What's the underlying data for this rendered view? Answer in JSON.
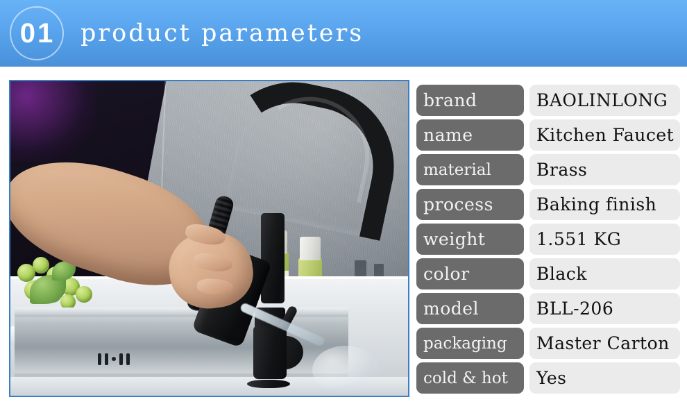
{
  "header": {
    "badge_number": "01",
    "title": "product parameters",
    "gradient_top": "#68b2f6",
    "gradient_bottom": "#4a90d9"
  },
  "photo": {
    "caption": "hand holding black pull-down kitchen faucet sprayer over stainless steel sink",
    "border_color": "#3c7ec4"
  },
  "spec_table": {
    "label_bg": "#6b6b6b",
    "value_bg": "#ebebeb",
    "rows": [
      {
        "label": "brand",
        "value": "BAOLINLONG"
      },
      {
        "label": "name",
        "value": "Kitchen Faucet"
      },
      {
        "label": "material",
        "value": "Brass"
      },
      {
        "label": "process",
        "value": "Baking finish"
      },
      {
        "label": "weight",
        "value": "1.551 KG"
      },
      {
        "label": "color",
        "value": "Black"
      },
      {
        "label": "model",
        "value": "BLL-206"
      },
      {
        "label": "packaging",
        "value": "Master Carton"
      },
      {
        "label": "cold & hot",
        "value": "Yes"
      }
    ]
  }
}
